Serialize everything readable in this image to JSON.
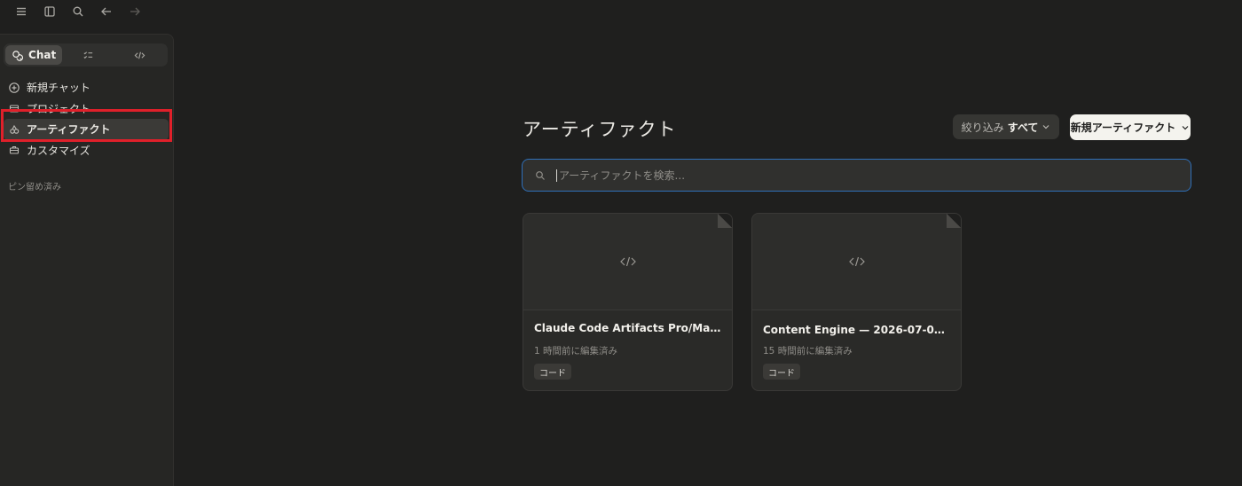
{
  "topbar": {
    "icons": [
      "menu-icon",
      "sidebar-toggle-icon",
      "search-icon",
      "arrow-left-icon",
      "arrow-right-icon"
    ]
  },
  "sidebar": {
    "mode_tabs": [
      {
        "label": "Chat",
        "icon": "chat-bubbles-icon",
        "active": true
      },
      {
        "label": "",
        "icon": "tasks-icon",
        "active": false
      },
      {
        "label": "",
        "icon": "code-icon",
        "active": false
      }
    ],
    "nav": [
      {
        "label": "新規チャット",
        "icon": "plus-icon"
      },
      {
        "label": "プロジェクト",
        "icon": "folder-icon"
      },
      {
        "label": "アーティファクト",
        "icon": "artifacts-icon",
        "active": true
      },
      {
        "label": "カスタマイズ",
        "icon": "briefcase-icon"
      }
    ],
    "section_label": "ピン留め済み"
  },
  "main": {
    "title": "アーティファクト",
    "filter": {
      "label": "絞り込み",
      "value": "すべて"
    },
    "new_button": "新規アーティファクト",
    "search_placeholder": "アーティファクトを検索...",
    "cards": [
      {
        "title": "Claude Code Artifacts Pro/Max …",
        "meta": "1 時間前に編集済み",
        "badge": "コード"
      },
      {
        "title": "Content Engine — 2026-07-04 進…",
        "meta": "15 時間前に編集済み",
        "badge": "コード"
      }
    ]
  },
  "colors": {
    "background": "#1f1f1e",
    "sidebar": "#262624",
    "highlight": "#e0202a",
    "search_focus": "#2f6fb8"
  }
}
